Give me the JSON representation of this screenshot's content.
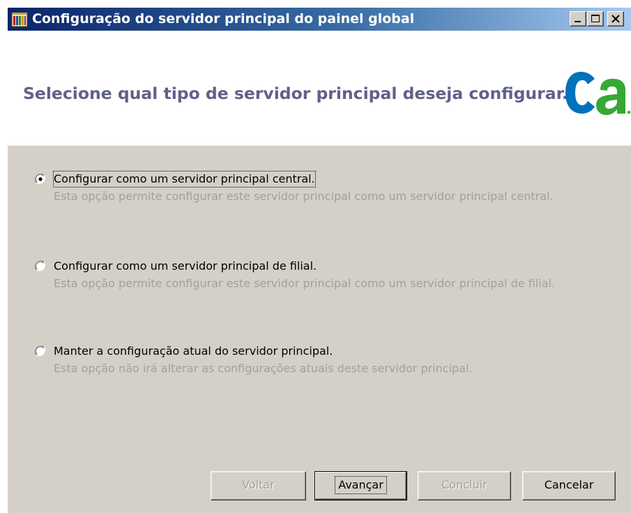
{
  "window": {
    "title": "Configuração do servidor principal do painel global",
    "controls": {
      "minimize_icon": "minimize-icon",
      "maximize_icon": "maximize-icon",
      "close_icon": "close-icon"
    }
  },
  "header": {
    "title": "Selecione qual tipo de servidor principal deseja configurar.",
    "logo": "ca",
    "logo_colors": {
      "c": "#0072bc",
      "a": "#36a935",
      "dot": "#36a935"
    }
  },
  "options": [
    {
      "label": "Configurar como um servidor principal central.",
      "description": "Esta opção permite configurar este servidor principal como um servidor principal central.",
      "selected": true
    },
    {
      "label": "Configurar como um servidor principal de filial.",
      "description": "Esta opção permite configurar este servidor principal como um servidor principal de filial.",
      "selected": false
    },
    {
      "label": "Manter a configuração atual do servidor principal.",
      "description": "Esta opção não irá alterar as configurações atuais deste servidor principal.",
      "selected": false
    }
  ],
  "buttons": {
    "back": {
      "label": "Voltar",
      "enabled": false
    },
    "next": {
      "label": "Avançar",
      "enabled": true,
      "default": true
    },
    "finish": {
      "label": "Concluir",
      "enabled": false
    },
    "cancel": {
      "label": "Cancelar",
      "enabled": true
    }
  }
}
